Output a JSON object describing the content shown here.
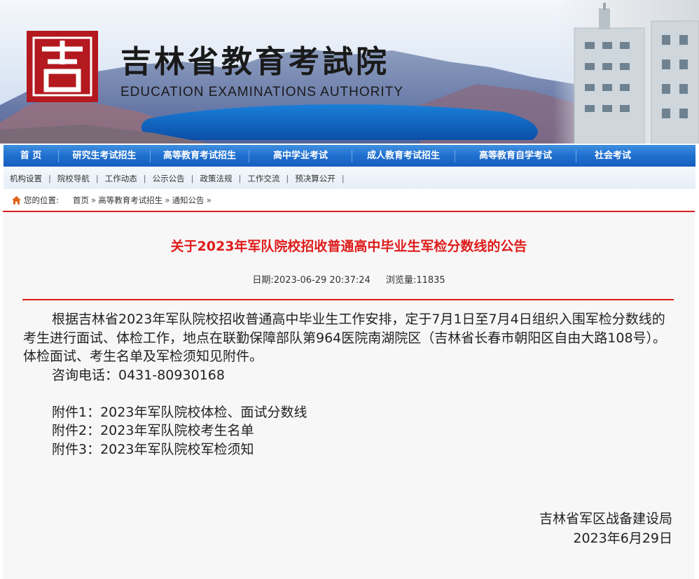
{
  "header": {
    "title": "吉林省教育考試院",
    "subtitle": "EDUCATION EXAMINATIONS AUTHORITY",
    "logo_glyph": "吉"
  },
  "main_nav": [
    {
      "label": "首 页"
    },
    {
      "label": "研究生考试招生"
    },
    {
      "label": "高等教育考试招生"
    },
    {
      "label": "高中学业考试"
    },
    {
      "label": "成人教育考试招生"
    },
    {
      "label": "高等教育自学考试"
    },
    {
      "label": "社会考试"
    }
  ],
  "sub_nav": [
    {
      "label": "机构设置"
    },
    {
      "label": "院校导航"
    },
    {
      "label": "工作动态"
    },
    {
      "label": "公示公告"
    },
    {
      "label": "政策法规"
    },
    {
      "label": "工作交流"
    },
    {
      "label": "预决算公开"
    }
  ],
  "breadcrumb": {
    "prefix": "您的位置:",
    "items": [
      {
        "label": "首页"
      },
      {
        "label": "高等教育考试招生"
      },
      {
        "label": "通知公告"
      }
    ]
  },
  "article": {
    "title": "关于2023年军队院校招收普通高中毕业生军检分数线的公告",
    "date_label": "日期:",
    "date": "2023-06-29 20:37:24",
    "views_label": "浏览量:",
    "views": "11835",
    "paragraph": "根据吉林省2023年军队院校招收普通高中毕业生工作安排，定于7月1日至7月4日组织入围军检分数线的考生进行面试、体检工作，地点在联勤保障部队第964医院南湖院区（吉林省长春市朝阳区自由大路108号）。体检面试、考生名单及军检须知见附件。",
    "phone": "咨询电话：0431-80930168",
    "attachments": [
      "附件1：2023年军队院校体检、面试分数线",
      "附件2：2023年军队院校考生名单",
      "附件3：2023年军队院校军检须知"
    ],
    "signature_org": "吉林省军区战备建设局",
    "signature_date": "2023年6月29日"
  },
  "colors": {
    "nav_blue": "#1f6fd0",
    "title_red": "#e01b1b",
    "logo_red": "#b3191f"
  }
}
